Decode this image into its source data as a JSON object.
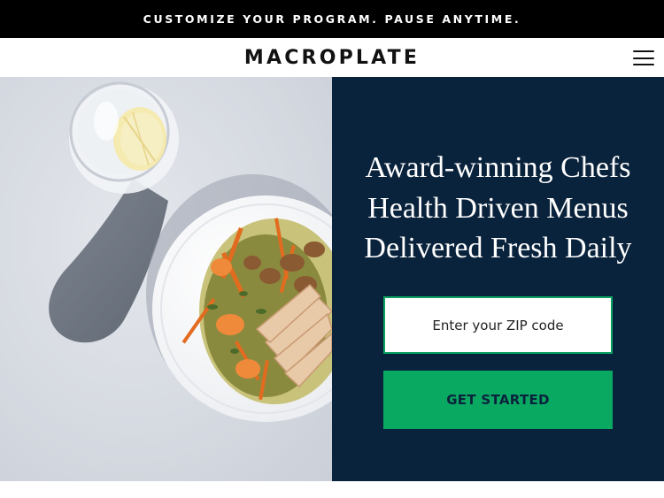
{
  "promo": {
    "text": "CUSTOMIZE YOUR PROGRAM. PAUSE ANYTIME."
  },
  "header": {
    "logo": "MACROPLATE",
    "menu_icon": "hamburger-menu-icon"
  },
  "hero": {
    "image_description_icon": "meal-photo",
    "headline": [
      "Award-winning Chefs",
      "Health Driven Menus",
      "Delivered Fresh Daily"
    ],
    "zip_placeholder": "Enter your ZIP code",
    "zip_value": "",
    "cta_label": "GET STARTED"
  },
  "colors": {
    "promo_bg": "#000000",
    "panel_bg": "#0a233c",
    "accent_green": "#0aa962",
    "text_dark": "#111111"
  }
}
